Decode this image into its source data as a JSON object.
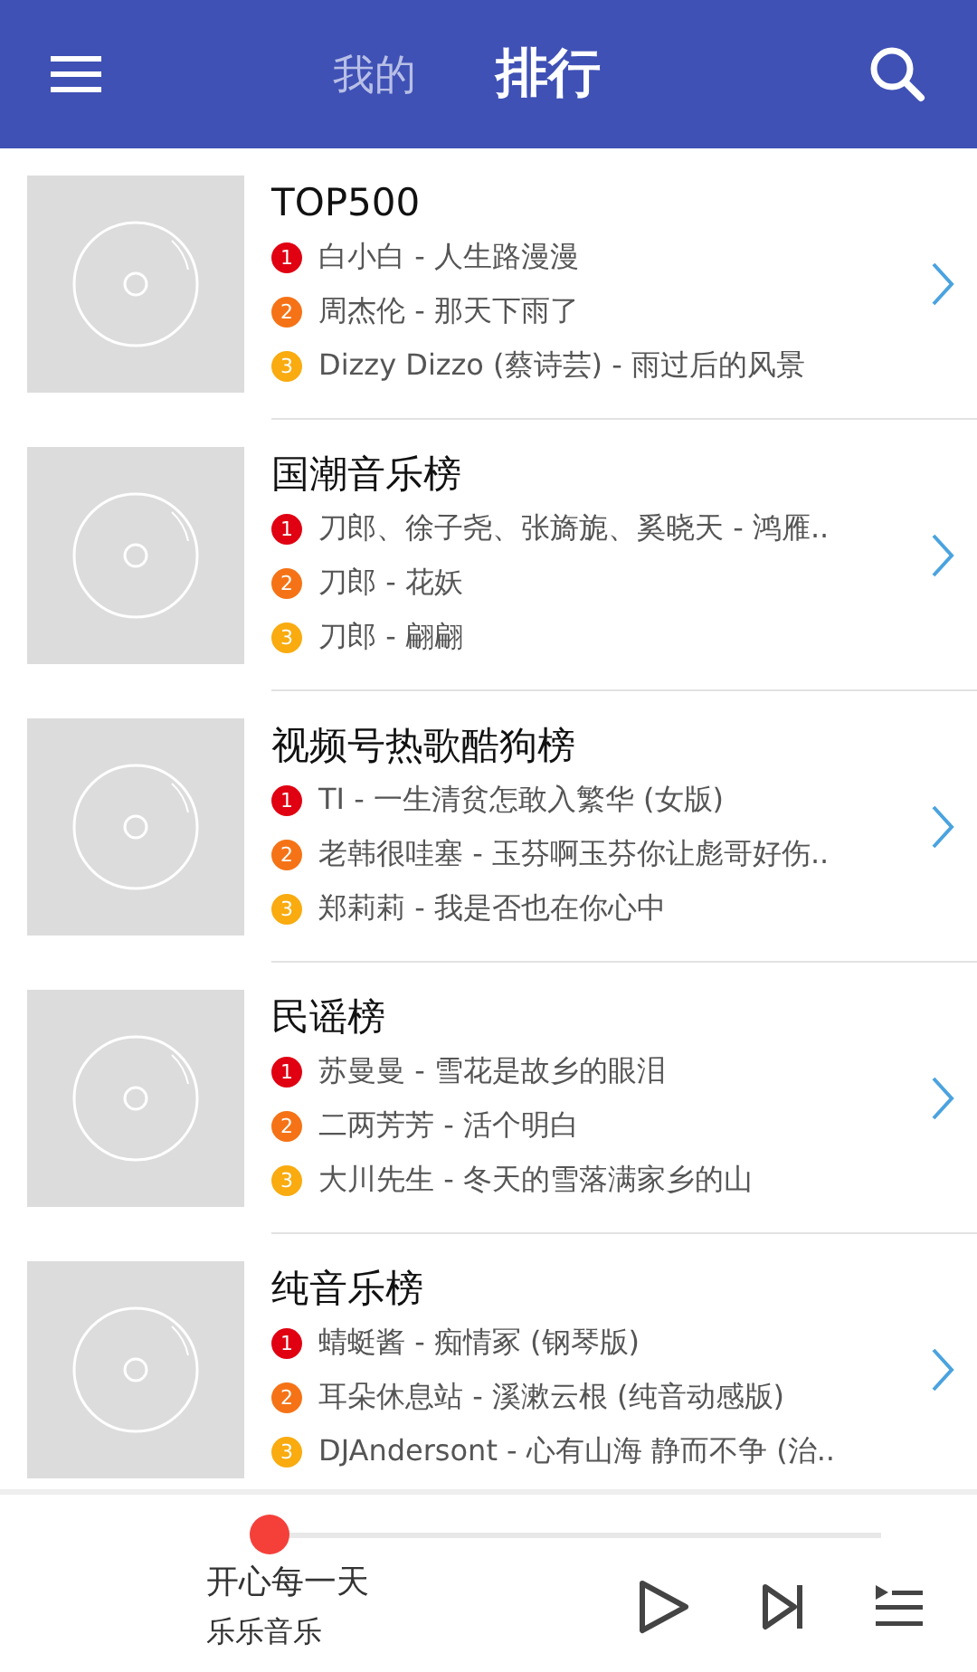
{
  "tabs": [
    {
      "label": "我的",
      "selected": false
    },
    {
      "label": "排行",
      "selected": true
    }
  ],
  "charts": [
    {
      "title": "TOP500",
      "songs": [
        {
          "rank": "1",
          "text": "白小白 - 人生路漫漫",
          "color": "#e00012"
        },
        {
          "rank": "2",
          "text": "周杰伦 - 那天下雨了",
          "color": "#f57316"
        },
        {
          "rank": "3",
          "text": "Dizzy Dizzo (蔡诗芸) - 雨过后的风景",
          "color": "#f9ab0f"
        }
      ]
    },
    {
      "title": "国潮音乐榜",
      "songs": [
        {
          "rank": "1",
          "text": "刀郎、徐子尧、张旖旎、奚晓天 - 鸿雁..",
          "color": "#e00012"
        },
        {
          "rank": "2",
          "text": "刀郎 - 花妖",
          "color": "#f57316"
        },
        {
          "rank": "3",
          "text": "刀郎 - 翩翩",
          "color": "#f9ab0f"
        }
      ]
    },
    {
      "title": "视频号热歌酷狗榜",
      "songs": [
        {
          "rank": "1",
          "text": "TI - 一生清贫怎敢入繁华 (女版)",
          "color": "#e00012"
        },
        {
          "rank": "2",
          "text": "老韩很哇塞 - 玉芬啊玉芬你让彪哥好伤..",
          "color": "#f57316"
        },
        {
          "rank": "3",
          "text": "郑莉莉 - 我是否也在你心中",
          "color": "#f9ab0f"
        }
      ]
    },
    {
      "title": "民谣榜",
      "songs": [
        {
          "rank": "1",
          "text": "苏曼曼 - 雪花是故乡的眼泪",
          "color": "#e00012"
        },
        {
          "rank": "2",
          "text": "二两芳芳 - 活个明白",
          "color": "#f57316"
        },
        {
          "rank": "3",
          "text": "大川先生 - 冬天的雪落满家乡的山",
          "color": "#f9ab0f"
        }
      ]
    },
    {
      "title": "纯音乐榜",
      "songs": [
        {
          "rank": "1",
          "text": "蜻蜓酱 - 痴情冢 (钢琴版)",
          "color": "#e00012"
        },
        {
          "rank": "2",
          "text": "耳朵休息站 - 溪漱云根 (纯音动感版)",
          "color": "#f57316"
        },
        {
          "rank": "3",
          "text": "DJAndersont - 心有山海 静而不争 (治..",
          "color": "#f9ab0f"
        }
      ]
    }
  ],
  "player": {
    "title": "开心每一天",
    "artist": "乐乐音乐",
    "level": 0
  }
}
